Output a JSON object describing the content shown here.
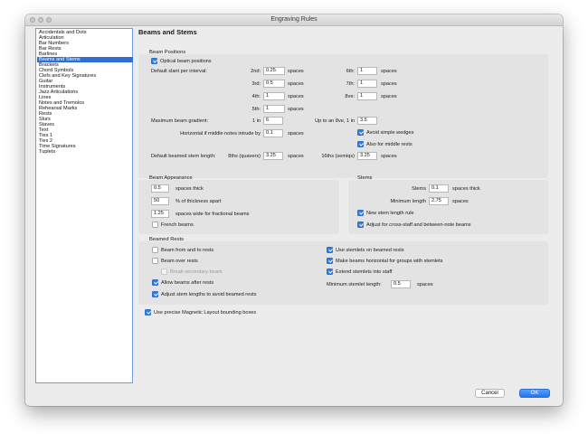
{
  "window": {
    "title": "Engraving Rules"
  },
  "sidebar": {
    "items": [
      {
        "label": "Accidentals and Dots",
        "selected": false
      },
      {
        "label": "Articulation",
        "selected": false
      },
      {
        "label": "Bar Numbers",
        "selected": false
      },
      {
        "label": "Bar Rests",
        "selected": false
      },
      {
        "label": "Barlines",
        "selected": false
      },
      {
        "label": "Beams and Stems",
        "selected": true
      },
      {
        "label": "Brackets",
        "selected": false
      },
      {
        "label": "Chord Symbols",
        "selected": false
      },
      {
        "label": "Clefs and Key Signatures",
        "selected": false
      },
      {
        "label": "Guitar",
        "selected": false
      },
      {
        "label": "Instruments",
        "selected": false
      },
      {
        "label": "Jazz Articulations",
        "selected": false
      },
      {
        "label": "Lines",
        "selected": false
      },
      {
        "label": "Notes and Tremolos",
        "selected": false
      },
      {
        "label": "Rehearsal Marks",
        "selected": false
      },
      {
        "label": "Rests",
        "selected": false
      },
      {
        "label": "Slurs",
        "selected": false
      },
      {
        "label": "Staves",
        "selected": false
      },
      {
        "label": "Text",
        "selected": false
      },
      {
        "label": "Ties 1",
        "selected": false
      },
      {
        "label": "Ties 2",
        "selected": false
      },
      {
        "label": "Time Signatures",
        "selected": false
      },
      {
        "label": "Tuplets",
        "selected": false
      }
    ]
  },
  "page": {
    "heading": "Beams and Stems"
  },
  "beam_positions": {
    "title": "Beam Positions",
    "optical_label": "Optical beam positions",
    "optical_checked": true,
    "slant_label": "Default slant per interval:",
    "unit": "spaces",
    "intervals": [
      {
        "label": "2nd:",
        "value": "0.25"
      },
      {
        "label": "3rd:",
        "value": "0.5"
      },
      {
        "label": "4th:",
        "value": "1"
      },
      {
        "label": "5th:",
        "value": "1"
      },
      {
        "label": "6th:",
        "value": "1"
      },
      {
        "label": "7th:",
        "value": "1"
      },
      {
        "label": "8ve:",
        "value": "1"
      }
    ],
    "max_gradient_label": "Maximum beam gradient:",
    "one_in": "1 in",
    "max_gradient_value": "6",
    "up_to_octave_label": "Up to an 8ve, 1 in",
    "up_to_octave_value": "3.5",
    "horizontal_label": "Horizontal if middle notes intrude by",
    "horizontal_value": "0.1",
    "avoid_wedges_label": "Avoid simple wedges",
    "avoid_wedges_checked": true,
    "middle_rests_label": "Also for middle rests",
    "middle_rests_checked": true,
    "stem_length_label": "Default beamed stem length:",
    "eighths_label": "8ths (quavers)",
    "eighths_value": "3.25",
    "sixteenths_label": "16ths (semiqs)",
    "sixteenths_value": "3.25"
  },
  "beam_appearance": {
    "title": "Beam Appearance",
    "thick_value": "0.5",
    "thick_label": "spaces thick",
    "apart_value": "50",
    "apart_label": "% of thickness apart",
    "fractional_value": "1.25",
    "fractional_label": "spaces wide for fractional beams",
    "french_label": "French beams",
    "french_checked": false
  },
  "stems": {
    "title": "Stems",
    "stems_label": "Stems",
    "stems_value": "0.1",
    "stems_unit": "spaces thick",
    "min_length_label": "Minimum length",
    "min_length_value": "2.75",
    "min_length_unit": "spaces",
    "new_rule_label": "New stem length rule",
    "new_rule_checked": true,
    "adjust_label": "Adjust for cross-staff and between-note beams",
    "adjust_checked": true
  },
  "beamed_rests": {
    "title": "Beamed Rests",
    "from_to_label": "Beam from and to rests",
    "from_to_checked": false,
    "over_label": "Beam over rests",
    "over_checked": false,
    "break_label": "Break secondary beam",
    "break_checked": false,
    "allow_after_label": "Allow beams after rests",
    "allow_after_checked": true,
    "adjust_stems_label": "Adjust stem lengths to avoid beamed rests",
    "adjust_stems_checked": true,
    "use_stemlets_label": "Use stemlets on beamed rests",
    "use_stemlets_checked": true,
    "horizontal_label": "Make beams horizontal for groups with stemlets",
    "horizontal_checked": true,
    "extend_label": "Extend stemlets into staff",
    "extend_checked": true,
    "min_stemlet_label": "Minimum stemlet length:",
    "min_stemlet_value": "0.5",
    "min_stemlet_unit": "spaces"
  },
  "magnetic": {
    "label": "Use precise Magnetic Layout bounding boxes",
    "checked": true
  },
  "buttons": {
    "cancel": "Cancel",
    "ok": "OK"
  },
  "colors": {
    "accent": "#2f7de6",
    "selection": "#2d6fd6",
    "panel": "#e3e3e3",
    "window": "#ececec"
  }
}
